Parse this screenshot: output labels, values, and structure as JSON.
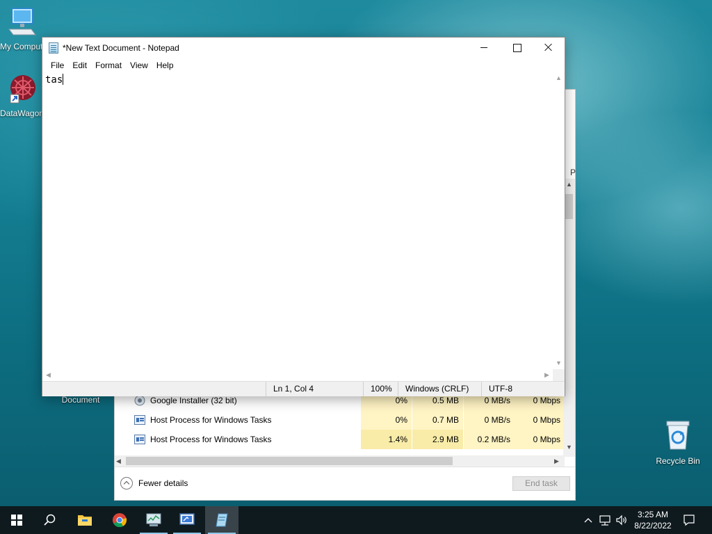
{
  "desktop": {
    "icons": [
      {
        "label": "My Computer"
      },
      {
        "label": "DataWagon"
      },
      {
        "label": "Document"
      },
      {
        "label": "Recycle Bin"
      }
    ]
  },
  "task_manager": {
    "rows": [
      {
        "name": "Google Installer (32 bit)",
        "cpu": "0%",
        "memory": "0.5 MB",
        "disk": "0 MB/s",
        "network": "0 Mbps"
      },
      {
        "name": "Host Process for Windows Tasks",
        "cpu": "0%",
        "memory": "0.7 MB",
        "disk": "0 MB/s",
        "network": "0 Mbps"
      },
      {
        "name": "Host Process for Windows Tasks",
        "cpu": "1.4%",
        "memory": "2.9 MB",
        "disk": "0.2 MB/s",
        "network": "0 Mbps"
      }
    ],
    "partial_header": "P",
    "fewer_details": "Fewer details",
    "end_task": "End task",
    "colors": {
      "highlight": "#fff4c4",
      "highlight_strong": "#f9eca8"
    }
  },
  "notepad": {
    "title": "*New Text Document - Notepad",
    "menu": [
      "File",
      "Edit",
      "Format",
      "View",
      "Help"
    ],
    "content": "tas",
    "status": {
      "position": "Ln 1, Col 4",
      "zoom": "100%",
      "line_ending": "Windows (CRLF)",
      "encoding": "UTF-8"
    }
  },
  "taskbar": {
    "time": "3:25 AM",
    "date": "8/22/2022",
    "apps": [
      "start-icon",
      "search-icon",
      "file-explorer-icon",
      "chrome-icon",
      "task-manager-icon",
      "control-panel-icon",
      "notepad-icon"
    ]
  }
}
